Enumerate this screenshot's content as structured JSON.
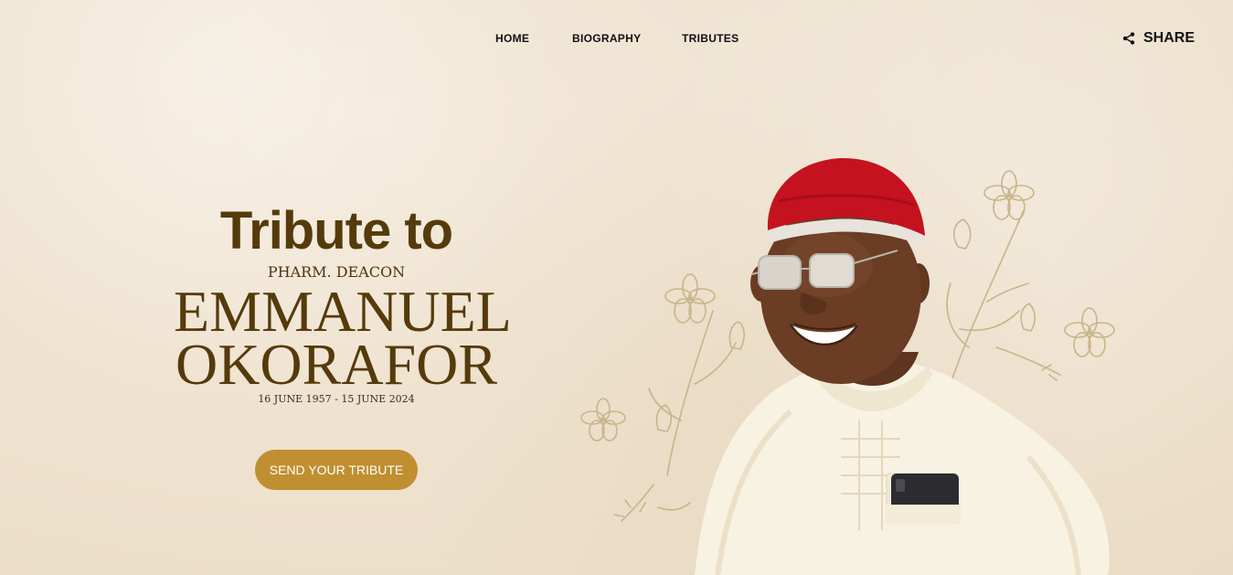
{
  "nav": {
    "items": [
      {
        "label": "HOME"
      },
      {
        "label": "BIOGRAPHY"
      },
      {
        "label": "TRIBUTES"
      }
    ],
    "share_label": "SHARE"
  },
  "hero": {
    "heading": "Tribute to",
    "title": "PHARM. DEACON",
    "name_line1": "EMMANUEL",
    "name_line2": "OKORAFOR",
    "dates": "16 JUNE 1957 - 15 JUNE 2024",
    "cta_label": "SEND YOUR TRIBUTE"
  },
  "colors": {
    "background": "#efe3d0",
    "text_brown": "#553a0b",
    "cta_gold": "#c08f31",
    "cap_red": "#c4121f",
    "garment_cream": "#f7f1e2"
  },
  "icons": {
    "share": "share-icon",
    "portrait": "portrait-illustration",
    "floral": "floral-decoration"
  }
}
